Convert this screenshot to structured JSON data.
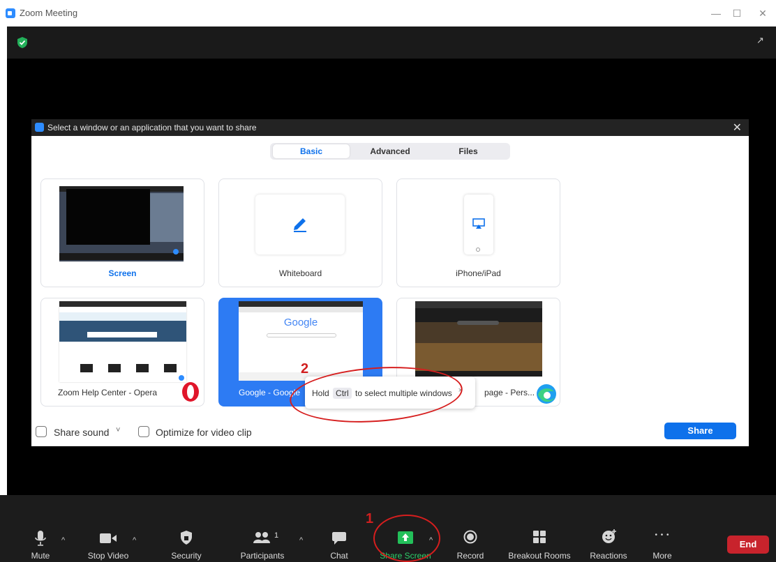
{
  "window": {
    "title": "Zoom Meeting",
    "minimize": "—",
    "maximize": "☐",
    "close": "✕"
  },
  "dialog": {
    "title": "Select a window or an application that you want to share",
    "close": "✕",
    "tabs": [
      {
        "label": "Basic",
        "active": true
      },
      {
        "label": "Advanced",
        "active": false
      },
      {
        "label": "Files",
        "active": false
      }
    ],
    "cards": [
      {
        "label": "Screen"
      },
      {
        "label": "Whiteboard"
      },
      {
        "label": "iPhone/iPad"
      },
      {
        "label": "Zoom Help Center - Opera"
      },
      {
        "label": "Google - Google"
      },
      {
        "label": "page - Pers..."
      }
    ],
    "google_thumb_text": "Google",
    "share_sound": "Share sound",
    "share_sound_caret": "˅",
    "optimize_video": "Optimize for video clip",
    "share_button": "Share"
  },
  "tooltip": {
    "before": "Hold",
    "key": "Ctrl",
    "after": "to select multiple windows",
    "close": "×"
  },
  "annotations": {
    "one": "1",
    "two": "2"
  },
  "toolbar": {
    "items": [
      {
        "label": "Mute"
      },
      {
        "label": "Stop Video"
      },
      {
        "label": "Security"
      },
      {
        "label": "Participants",
        "count": "1"
      },
      {
        "label": "Chat"
      },
      {
        "label": "Share Screen"
      },
      {
        "label": "Record"
      },
      {
        "label": "Breakout Rooms"
      },
      {
        "label": "Reactions"
      },
      {
        "label": "More"
      }
    ],
    "caret": "^",
    "more_dots": "• • •",
    "end_button": "End"
  },
  "colors": {
    "accent": "#0e71eb",
    "selected_card": "#2d7bf3",
    "share_green": "#23c05a",
    "end_red": "#c8232c",
    "annotation_red": "#d61e1e"
  }
}
